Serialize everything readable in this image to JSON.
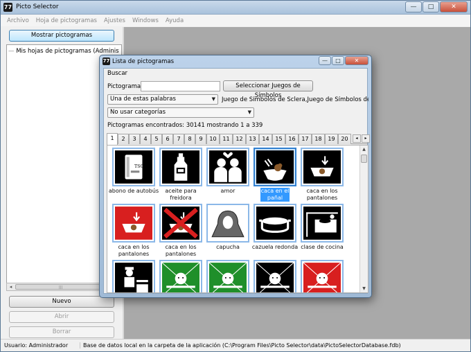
{
  "window": {
    "title": "Picto Selector",
    "app_icon": "77",
    "controls": {
      "minimize": "—",
      "maximize": "□",
      "close": "✕"
    }
  },
  "menu": [
    "Archivo",
    "Hoja de pictogramas",
    "Ajustes",
    "Windows",
    "Ayuda"
  ],
  "left": {
    "show_button": "Mostrar pictogramas",
    "tree_item": "Mis hojas de pictogramas (Administrador)",
    "new_button": "Nuevo",
    "open_button": "Abrir",
    "delete_button": "Borrar"
  },
  "status": {
    "user": "Usuario: Administrador",
    "db": "Base de datos local en la carpeta de la aplicación (C:\\Program Files\\Picto Selector\\data\\PictoSelectorDatabase.fdb)"
  },
  "dialog": {
    "title": "Lista de pictogramas",
    "search_label": "Buscar",
    "picto_label": "Pictograma",
    "search_value": "",
    "select_sets_button": "Seleccionar Juegos de Símbolos",
    "word_mode": "Una de estas palabras",
    "sets_text": "Juego de Símbolos de Sclera,Juego de Símbolos de Mu",
    "category": "No usar categorías",
    "count": "Pictogramas encontrados: 30141 mostrando 1 a 339",
    "tabs": [
      "1",
      "2",
      "3",
      "4",
      "5",
      "6",
      "7",
      "8",
      "9",
      "10",
      "11",
      "12",
      "13",
      "14",
      "15",
      "16",
      "17",
      "18",
      "19",
      "20"
    ],
    "tab_prev": "◂",
    "tab_next": "▸",
    "active_tab": "1",
    "items": [
      {
        "caption": "abono de autobús",
        "icon": "bus-pass-icon"
      },
      {
        "caption": "aceite para freidora",
        "icon": "oil-bottle-icon"
      },
      {
        "caption": "amor",
        "icon": "love-couple-icon"
      },
      {
        "caption": "caca en el pañal",
        "icon": "diaper-poop-icon"
      },
      {
        "caption": "caca en los pantalones",
        "icon": "pants-poop-icon"
      },
      {
        "caption": "caca en los pantalones",
        "icon": "pants-poop-red-icon"
      },
      {
        "caption": "caca en los pantalones",
        "icon": "pants-poop-crossed-icon"
      },
      {
        "caption": "capucha",
        "icon": "hood-icon"
      },
      {
        "caption": "cazuela redonda",
        "icon": "round-pot-icon"
      },
      {
        "caption": "clase de cocina",
        "icon": "cooking-class-icon"
      },
      {
        "caption": "",
        "icon": "cook-icon"
      },
      {
        "caption": "",
        "icon": "plate-green-icon"
      },
      {
        "caption": "",
        "icon": "plate-green-icon"
      },
      {
        "caption": "",
        "icon": "plate-dark-icon"
      },
      {
        "caption": "",
        "icon": "plate-red-icon"
      }
    ],
    "selected_index": 3
  }
}
